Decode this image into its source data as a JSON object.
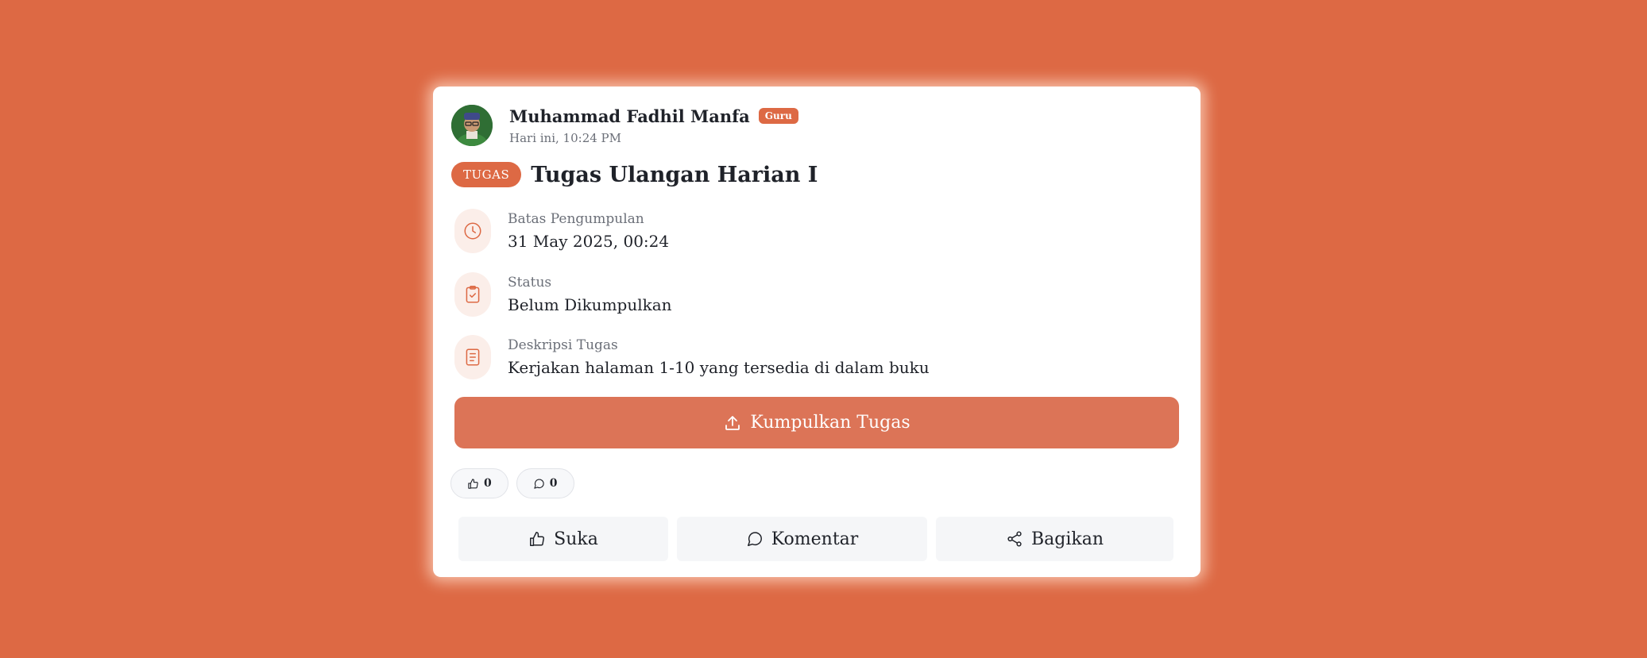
{
  "post": {
    "author": "Muhammad Fadhil Manfa",
    "role": "Guru",
    "time": "Hari ini, 10:24 PM"
  },
  "task": {
    "type": "TUGAS",
    "title": "Tugas Ulangan Harian I"
  },
  "details": [
    {
      "label": "Batas Pengumpulan",
      "value": "31 May 2025, 00:24",
      "icon": "clock-icon"
    },
    {
      "label": "Status",
      "value": "Belum Dikumpulkan",
      "icon": "clipboard-check-icon"
    },
    {
      "label": "Deskripsi Tugas",
      "value": "Kerjakan halaman 1-10 yang tersedia di dalam buku",
      "icon": "document-icon"
    }
  ],
  "submit": {
    "label": "Kumpulkan Tugas",
    "icon": "upload-icon"
  },
  "counts": {
    "likes": "0",
    "comments": "0"
  },
  "actions": {
    "like": "Suka",
    "comment": "Komentar",
    "share": "Bagikan"
  },
  "colors": {
    "accent": "#dd6944",
    "button": "#dc7457",
    "icon_bg": "#fbeee9"
  }
}
